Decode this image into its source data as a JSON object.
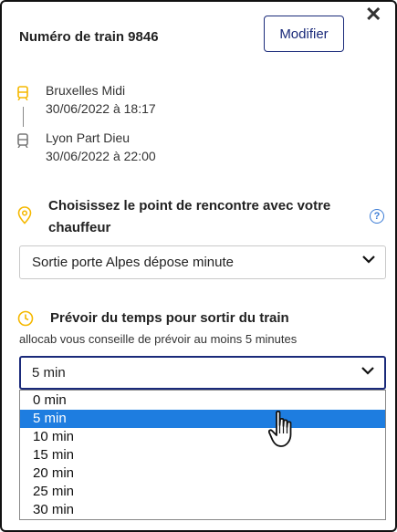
{
  "header": {
    "title": "Numéro de train 9846",
    "modify_label": "Modifier",
    "close_label": "✕"
  },
  "trip": {
    "departure": {
      "station": "Bruxelles Midi",
      "datetime": "30/06/2022 à 18:17"
    },
    "arrival": {
      "station": "Lyon Part Dieu",
      "datetime": "30/06/2022 à 22:00"
    }
  },
  "meeting_point": {
    "title_line1": "Choisissez le point de rencontre avec votre",
    "title_line2": "chauffeur",
    "help_label": "?",
    "selected": "Sortie porte Alpes dépose minute"
  },
  "exit_time": {
    "title": "Prévoir du temps pour sortir du train",
    "hint": "allocab vous conseille de prévoir au moins 5 minutes",
    "selected": "5 min",
    "options": [
      "0 min",
      "5 min",
      "10 min",
      "15 min",
      "20 min",
      "25 min",
      "30 min"
    ],
    "highlighted_index": 1
  },
  "colors": {
    "accent": "#1a2a7a",
    "highlight": "#1e7de0",
    "icon_yellow": "#f5b800"
  }
}
